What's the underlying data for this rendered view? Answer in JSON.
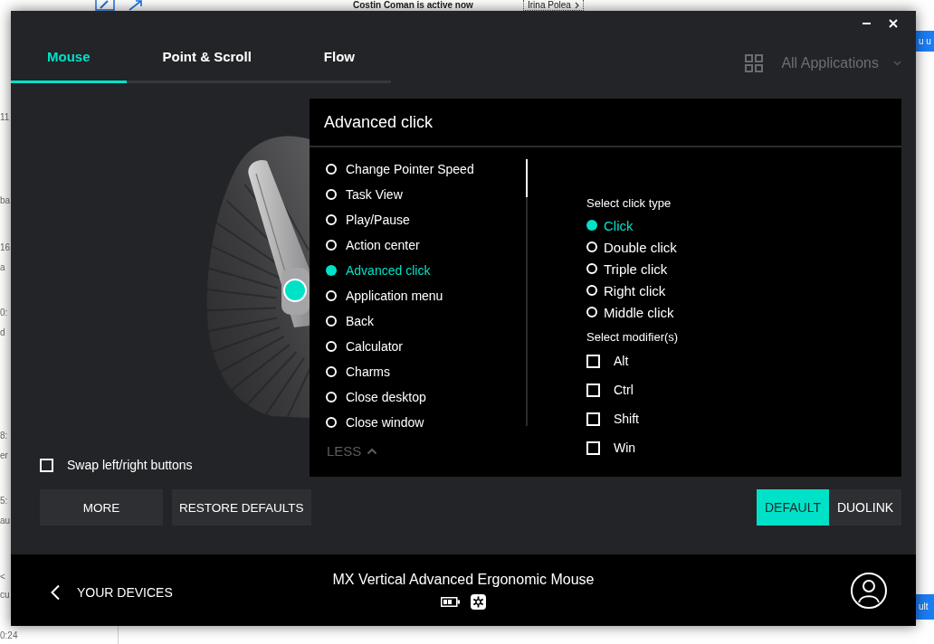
{
  "backdrop": {
    "status_text": "Costin Coman is active now",
    "contact_label": "Irina Polea",
    "side_fragments": [
      "11",
      "ba",
      "16",
      "a",
      "0:",
      "d",
      "8:",
      "er",
      "5:",
      "au",
      "<",
      "cu",
      "0:24"
    ],
    "right_banners": [
      "u u",
      "ult"
    ]
  },
  "window": {
    "tabs": [
      {
        "label": "Mouse",
        "selected": true
      },
      {
        "label": "Point & Scroll",
        "selected": false
      },
      {
        "label": "Flow",
        "selected": false
      }
    ],
    "app_selector": {
      "label": "All Applications"
    },
    "device_markers": [
      {
        "selected": true
      }
    ],
    "action_panel": {
      "title": "Advanced click",
      "actions": [
        {
          "label": "Change Pointer Speed",
          "selected": false
        },
        {
          "label": "Task View",
          "selected": false
        },
        {
          "label": "Play/Pause",
          "selected": false
        },
        {
          "label": "Action center",
          "selected": false
        },
        {
          "label": "Advanced click",
          "selected": true
        },
        {
          "label": "Application menu",
          "selected": false
        },
        {
          "label": "Back",
          "selected": false
        },
        {
          "label": "Calculator",
          "selected": false
        },
        {
          "label": "Charms",
          "selected": false
        },
        {
          "label": "Close desktop",
          "selected": false
        },
        {
          "label": "Close window",
          "selected": false
        }
      ],
      "less_label": "LESS",
      "click_type": {
        "heading": "Select click type",
        "options": [
          {
            "label": "Click",
            "selected": true
          },
          {
            "label": "Double click",
            "selected": false
          },
          {
            "label": "Triple click",
            "selected": false
          },
          {
            "label": "Right click",
            "selected": false
          },
          {
            "label": "Middle click",
            "selected": false
          }
        ]
      },
      "modifiers": {
        "heading": "Select modifier(s)",
        "options": [
          {
            "label": "Alt",
            "checked": false
          },
          {
            "label": "Ctrl",
            "checked": false
          },
          {
            "label": "Shift",
            "checked": false
          },
          {
            "label": "Win",
            "checked": false
          }
        ]
      }
    },
    "swap_buttons": {
      "label": "Swap left/right buttons",
      "checked": false
    },
    "buttons": [
      {
        "label": "MORE"
      },
      {
        "label": "RESTORE DEFAULTS"
      }
    ],
    "mode_toggle": [
      {
        "label": "DEFAULT",
        "selected": true
      },
      {
        "label": "DUOLINK",
        "selected": false
      }
    ],
    "footer": {
      "back_label": "YOUR DEVICES",
      "device_name": "MX Vertical Advanced Ergonomic Mouse"
    }
  }
}
